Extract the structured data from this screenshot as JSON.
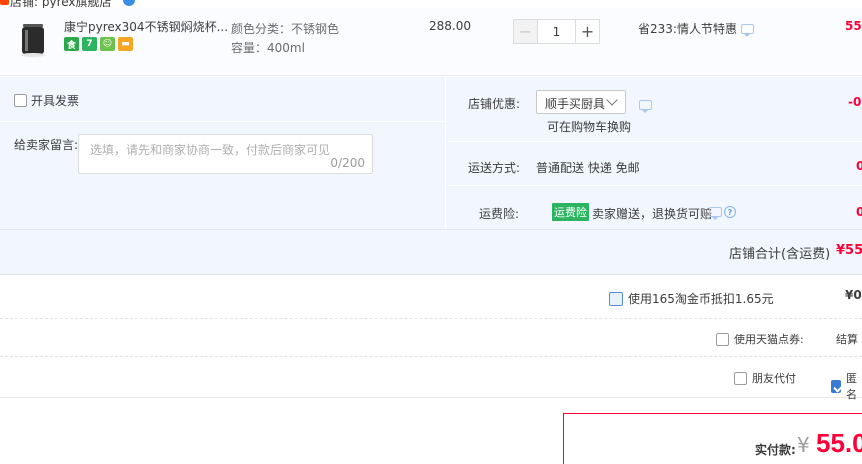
{
  "shop": {
    "name": "店铺: pyrex旗舰店"
  },
  "item": {
    "title": "康宁pyrex304不锈钢焖烧杯...",
    "sku_color": "颜色分类：不锈钢色",
    "sku_capacity": "容量：400ml",
    "price": "288.00",
    "quantity": "1",
    "qty_minus": "−",
    "qty_plus": "+",
    "promo": "省233:情人节特惠",
    "subtotal": "55",
    "badges": [
      {
        "icon": "food-badge-icon",
        "color": "#2aa84a",
        "text": "食"
      },
      {
        "icon": "seven-day-return-icon",
        "color": "#2db460",
        "text": "7"
      },
      {
        "icon": "certified-icon",
        "color": "#6cc24a",
        "text": "☺"
      },
      {
        "icon": "card-payment-icon",
        "color": "#f5a623",
        "text": "▬"
      }
    ]
  },
  "options": {
    "invoice_label": "开具发票",
    "message_label": "给卖家留言:",
    "message_placeholder": "选填，请先和商家协商一致，付款后商家可见",
    "message_count": "0/200",
    "shop_discount_label": "店铺优惠:",
    "shop_discount_value": "顺手买厨具",
    "cart_note": "可在购物车换购",
    "shop_discount_amount": "-0",
    "shipping_label": "运送方式:",
    "shipping_value": "普通配送 快递 免邮",
    "shipping_amount": "0",
    "insurance_label": "运费险:",
    "insurance_tag": "运费险",
    "insurance_text": "卖家赠送，退换货可赔",
    "insurance_amount": "0"
  },
  "totals": {
    "shop_total_label": "店铺合计(含运费)",
    "shop_total_amount": "¥55",
    "coin_label": "使用165淘金币抵扣1.65元",
    "coin_amount": "¥0",
    "tmall_label": "使用天猫点券:",
    "tmall_right": "结算",
    "friend_label": "朋友代付",
    "anon_label": "匿名",
    "pay_label": "实付款:",
    "pay_yen": "¥",
    "pay_amount": "55.0"
  }
}
